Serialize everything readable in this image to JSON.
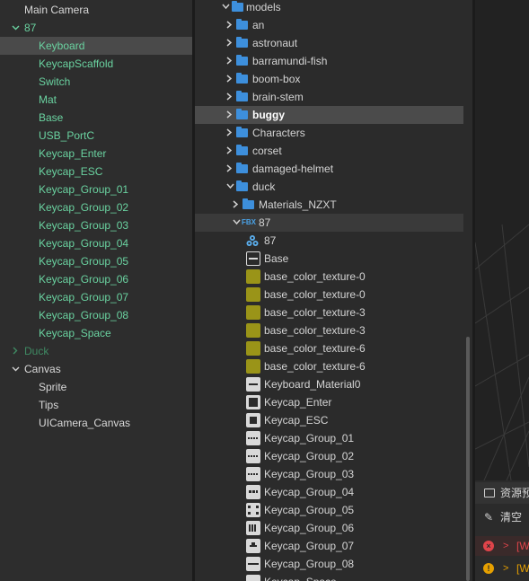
{
  "hierarchy": {
    "items": [
      {
        "label": "Main Camera",
        "tone": "white",
        "indent": 0,
        "arrow": ""
      },
      {
        "label": "87",
        "tone": "green",
        "indent": 0,
        "arrow": "v"
      },
      {
        "label": "Keyboard",
        "tone": "green",
        "indent": 1,
        "arrow": "",
        "selected": true
      },
      {
        "label": "KeycapScaffold",
        "tone": "green",
        "indent": 1,
        "arrow": ""
      },
      {
        "label": "Switch",
        "tone": "green",
        "indent": 1,
        "arrow": ""
      },
      {
        "label": "Mat",
        "tone": "green",
        "indent": 1,
        "arrow": ""
      },
      {
        "label": "Base",
        "tone": "green",
        "indent": 1,
        "arrow": ""
      },
      {
        "label": "USB_PortC",
        "tone": "green",
        "indent": 1,
        "arrow": ""
      },
      {
        "label": "Keycap_Enter",
        "tone": "green",
        "indent": 1,
        "arrow": ""
      },
      {
        "label": "Keycap_ESC",
        "tone": "green",
        "indent": 1,
        "arrow": ""
      },
      {
        "label": "Keycap_Group_01",
        "tone": "green",
        "indent": 1,
        "arrow": ""
      },
      {
        "label": "Keycap_Group_02",
        "tone": "green",
        "indent": 1,
        "arrow": ""
      },
      {
        "label": "Keycap_Group_03",
        "tone": "green",
        "indent": 1,
        "arrow": ""
      },
      {
        "label": "Keycap_Group_04",
        "tone": "green",
        "indent": 1,
        "arrow": ""
      },
      {
        "label": "Keycap_Group_05",
        "tone": "green",
        "indent": 1,
        "arrow": ""
      },
      {
        "label": "Keycap_Group_06",
        "tone": "green",
        "indent": 1,
        "arrow": ""
      },
      {
        "label": "Keycap_Group_07",
        "tone": "green",
        "indent": 1,
        "arrow": ""
      },
      {
        "label": "Keycap_Group_08",
        "tone": "green",
        "indent": 1,
        "arrow": ""
      },
      {
        "label": "Keycap_Space",
        "tone": "green",
        "indent": 1,
        "arrow": ""
      },
      {
        "label": "Duck",
        "tone": "dim-green",
        "indent": 0,
        "arrow": ">"
      },
      {
        "label": "Canvas",
        "tone": "white",
        "indent": 0,
        "arrow": "v"
      },
      {
        "label": "Sprite",
        "tone": "white",
        "indent": 1,
        "arrow": ""
      },
      {
        "label": "Tips",
        "tone": "white",
        "indent": 1,
        "arrow": ""
      },
      {
        "label": "UICamera_Canvas",
        "tone": "white",
        "indent": 1,
        "arrow": ""
      }
    ]
  },
  "assets": {
    "items": [
      {
        "label": "models",
        "icon": "folder-icon",
        "arrow": "down",
        "level": 0
      },
      {
        "label": "an",
        "icon": "folder-icon",
        "arrow": "right",
        "level": 1
      },
      {
        "label": "astronaut",
        "icon": "folder-icon",
        "arrow": "right",
        "level": 1
      },
      {
        "label": "barramundi-fish",
        "icon": "folder-icon",
        "arrow": "right",
        "level": 1
      },
      {
        "label": "boom-box",
        "icon": "folder-icon",
        "arrow": "right",
        "level": 1
      },
      {
        "label": "brain-stem",
        "icon": "folder-icon",
        "arrow": "right",
        "level": 1
      },
      {
        "label": "buggy",
        "icon": "folder-icon",
        "arrow": "right",
        "level": 1,
        "highlight": true,
        "bold": true
      },
      {
        "label": "Characters",
        "icon": "folder-icon",
        "arrow": "right",
        "level": 1
      },
      {
        "label": "corset",
        "icon": "folder-icon",
        "arrow": "right",
        "level": 1
      },
      {
        "label": "damaged-helmet",
        "icon": "folder-icon",
        "arrow": "right",
        "level": 1
      },
      {
        "label": "duck",
        "icon": "folder-icon",
        "arrow": "down",
        "level": 1
      },
      {
        "label": "Materials_NZXT",
        "icon": "folder-icon",
        "arrow": "right",
        "level": 2
      },
      {
        "label": "87",
        "icon": "fbx-icon",
        "arrow": "down",
        "level": 2,
        "openrow": true
      },
      {
        "label": "87",
        "icon": "prefab-icon",
        "arrow": "",
        "level": 3
      },
      {
        "label": "Base",
        "icon": "mesh-base-icon",
        "arrow": "",
        "level": 3
      },
      {
        "label": "base_color_texture-0",
        "icon": "texture-icon",
        "arrow": "",
        "level": 3
      },
      {
        "label": "base_color_texture-0",
        "icon": "texture-icon",
        "arrow": "",
        "level": 3
      },
      {
        "label": "base_color_texture-3",
        "icon": "texture-icon",
        "arrow": "",
        "level": 3
      },
      {
        "label": "base_color_texture-3",
        "icon": "texture-icon",
        "arrow": "",
        "level": 3
      },
      {
        "label": "base_color_texture-6",
        "icon": "texture-icon",
        "arrow": "",
        "level": 3
      },
      {
        "label": "base_color_texture-6",
        "icon": "texture-icon",
        "arrow": "",
        "level": 3
      },
      {
        "label": "Keyboard_Material0",
        "icon": "mesh-icon",
        "arrow": "",
        "level": 3
      },
      {
        "label": "Keycap_Enter",
        "icon": "mesh-icon",
        "arrow": "",
        "level": 3
      },
      {
        "label": "Keycap_ESC",
        "icon": "mesh-icon",
        "arrow": "",
        "level": 3
      },
      {
        "label": "Keycap_Group_01",
        "icon": "mesh-icon",
        "arrow": "",
        "level": 3
      },
      {
        "label": "Keycap_Group_02",
        "icon": "mesh-icon",
        "arrow": "",
        "level": 3
      },
      {
        "label": "Keycap_Group_03",
        "icon": "mesh-icon",
        "arrow": "",
        "level": 3
      },
      {
        "label": "Keycap_Group_04",
        "icon": "mesh-icon",
        "arrow": "",
        "level": 3
      },
      {
        "label": "Keycap_Group_05",
        "icon": "mesh-icon",
        "arrow": "",
        "level": 3
      },
      {
        "label": "Keycap_Group_06",
        "icon": "mesh-icon",
        "arrow": "",
        "level": 3
      },
      {
        "label": "Keycap_Group_07",
        "icon": "mesh-icon",
        "arrow": "",
        "level": 3
      },
      {
        "label": "Keycap_Group_08",
        "icon": "mesh-icon",
        "arrow": "",
        "level": 3
      },
      {
        "label": "Keycap_Space",
        "icon": "mesh-icon",
        "arrow": "",
        "level": 3
      }
    ]
  },
  "console": {
    "tab_label": "资源预",
    "clear_label": "清空",
    "error_text": "[W",
    "warning_text": "[W"
  },
  "colors": {
    "accent_green": "#6ad2a0",
    "folder_blue": "#3d8fdc",
    "texture_yellow": "#9a9418",
    "error_red": "#e0444a",
    "warning_orange": "#e6a000"
  }
}
